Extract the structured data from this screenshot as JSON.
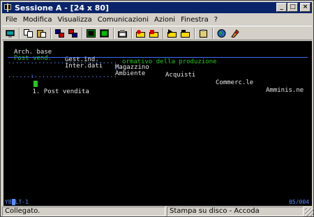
{
  "window": {
    "title": "Sessione A - [24 x 80]",
    "controls": {
      "minimize": "_",
      "maximize": "□",
      "close": "×"
    }
  },
  "menubar": {
    "items": [
      {
        "label": "File"
      },
      {
        "label": "Modifica"
      },
      {
        "label": "Visualizza"
      },
      {
        "label": "Comunicazioni"
      },
      {
        "label": "Azioni"
      },
      {
        "label": "Finestra"
      },
      {
        "label": "?"
      }
    ]
  },
  "toolbar": {
    "buttons": [
      "print-screen-icon",
      "copy-icon",
      "paste-icon",
      "send-file-icon",
      "receive-file-icon",
      "display-setup-icon",
      "keyboard-map-icon",
      "macro-icon",
      "record-macro-icon",
      "stop-macro-icon",
      "play-macro-icon",
      "run-macro-icon",
      "clipboard-icon",
      "globe-icon",
      "help-icon"
    ]
  },
  "terminal": {
    "menu_row1": [
      "Arch. base",
      "Gest.ind.",
      "Magazzino",
      "Acquisti",
      "Commerc.le",
      "Amminis.ne"
    ],
    "menu_row2": [
      "Post vend.",
      "Inter.dati",
      "Ambiente"
    ],
    "box_top": ".............................",
    "header_text": "ormativo della produzione",
    "box_item": "1. Post vendita",
    "box_side": ":",
    "box_bottom": ".............................",
    "colors": {
      "background": "#000000",
      "text": "#e8e8e8",
      "highlight": "#24c91e",
      "rule": "#3c6cff"
    }
  },
  "operator_line": {
    "left": "YB",
    "left_after_cursor": "LT-1",
    "right": "05/004"
  },
  "statusbar": {
    "status": "Collegato.",
    "print": "Stampa su disco - Accoda"
  }
}
